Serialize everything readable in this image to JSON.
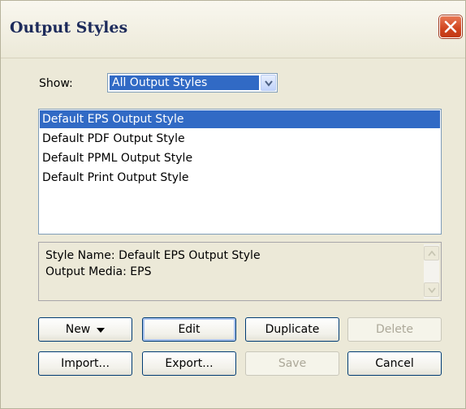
{
  "window": {
    "title": "Output Styles"
  },
  "show": {
    "label": "Show:",
    "selected": "All Output Styles"
  },
  "styles_list": {
    "items": [
      {
        "label": "Default EPS Output Style",
        "selected": true
      },
      {
        "label": "Default PDF Output Style",
        "selected": false
      },
      {
        "label": "Default PPML Output Style",
        "selected": false
      },
      {
        "label": "Default Print Output Style",
        "selected": false
      }
    ]
  },
  "info": {
    "style_name": "Style Name: Default EPS Output Style",
    "output_media": "Output Media: EPS"
  },
  "buttons": {
    "new": "New",
    "edit": "Edit",
    "duplicate": "Duplicate",
    "delete": "Delete",
    "import": "Import...",
    "export": "Export...",
    "save": "Save",
    "cancel": "Cancel"
  },
  "colors": {
    "selection": "#316ac5",
    "dialog_bg": "#ece9d8",
    "close_red": "#d0441e"
  }
}
